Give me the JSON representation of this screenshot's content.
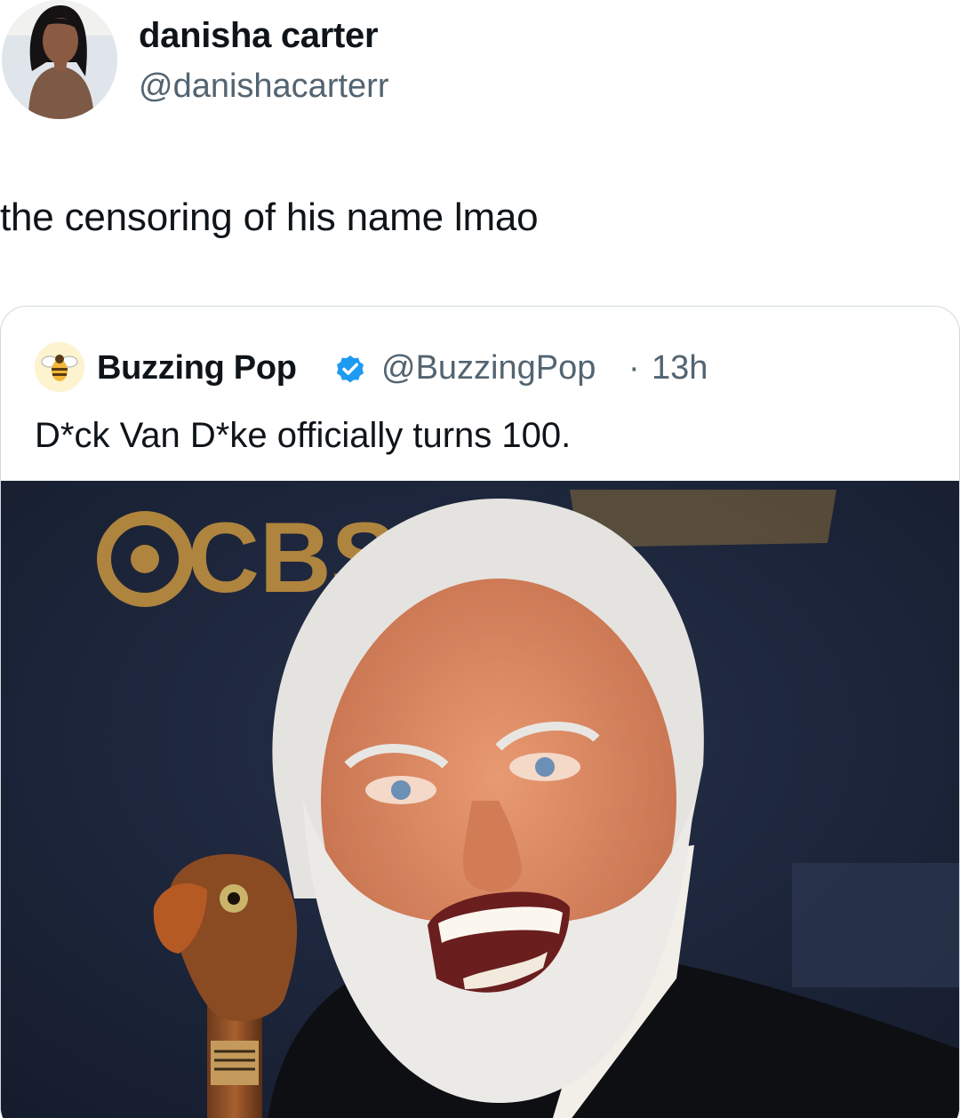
{
  "tweet": {
    "author": {
      "display_name": "danisha carter",
      "handle": "@danishacarterr",
      "avatar_icon": "profile-photo"
    },
    "text": "the censoring of his name lmao"
  },
  "quoted_tweet": {
    "author": {
      "display_name": "Buzzing Pop",
      "handle": "@BuzzingPop",
      "avatar_icon": "bee-logo",
      "verified_icon": "verified-badge-icon",
      "verified_color": "#1d9bf0"
    },
    "separator": "·",
    "time": "13h",
    "text": "D*ck Van D*ke officially turns 100.",
    "media": {
      "backdrop_logo": "CBS",
      "backdrop_accent": "#c9953f",
      "backdrop_color": "#1a2236"
    }
  },
  "colors": {
    "text_primary": "#0f1419",
    "text_secondary": "#536471",
    "card_border": "#cfd9de"
  }
}
